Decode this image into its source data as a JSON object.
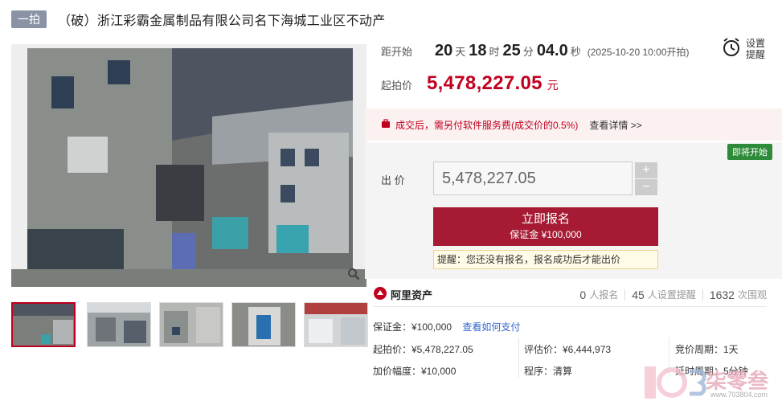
{
  "header": {
    "tag": "一拍",
    "title": "（破）浙江彩霸金属制品有限公司名下海城工业区不动产"
  },
  "timer": {
    "label": "距开始",
    "days": "20",
    "days_unit": "天",
    "hours": "18",
    "hours_unit": "时",
    "minutes": "25",
    "minutes_unit": "分",
    "seconds": "04.0",
    "seconds_unit": "秒",
    "start_text": "(2025-10-20 10:00开拍)"
  },
  "reminder": {
    "label": "设置提醒"
  },
  "start_price": {
    "label": "起拍价",
    "value": "5,478,227.05",
    "unit": "元"
  },
  "fee": {
    "text": "成交后，需另付软件服务费(成交价的0.5%)",
    "link": "查看详情 >>"
  },
  "bid": {
    "badge": "即将开始",
    "label": "出 价",
    "value": "5,478,227.05",
    "plus": "+",
    "minus": "−",
    "signup_main": "立即报名",
    "signup_sub": "保证金 ¥100,000",
    "notice": "提醒：您还没有报名，报名成功后才能出价"
  },
  "stats": {
    "logo": "阿里资产",
    "signups_num": "0",
    "signups_label": "人报名",
    "reminders_num": "45",
    "reminders_label": "人设置提醒",
    "views_num": "1632",
    "views_label": "次围观"
  },
  "info": {
    "deposit": "保证金：¥100,000",
    "deposit_link": "查看如何支付",
    "start_price": "起拍价：¥5,478,227.05",
    "eval_price": "评估价：¥6,444,973",
    "cycle": "竞价周期：1天",
    "increment": "加价幅度：¥10,000",
    "procedure": "程序：清算",
    "delay": "延时周期：5分钟"
  },
  "watermark": {
    "text": "柒零叁",
    "url": "www.703804.com"
  },
  "colors": {
    "accent": "#c1001f",
    "button": "#a61b33",
    "badge_green": "#2e8b3a",
    "link": "#3366cc"
  },
  "icons": {
    "zoom": "magnifier-icon",
    "alarm": "alarm-clock-icon",
    "fee": "bag-icon",
    "logo": "ali-logo-icon"
  }
}
